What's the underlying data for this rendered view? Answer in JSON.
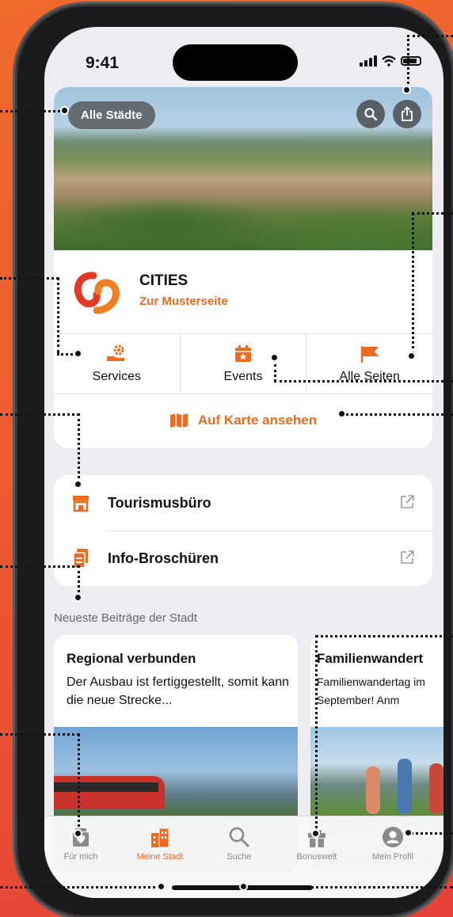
{
  "status": {
    "time": "9:41"
  },
  "header": {
    "all_cities": "Alle Städte"
  },
  "city": {
    "name": "CITIES",
    "link": "Zur Musterseite"
  },
  "actions": [
    {
      "label": "Services",
      "icon": "services-icon"
    },
    {
      "label": "Events",
      "icon": "calendar-star-icon"
    },
    {
      "label": "Alle Seiten",
      "icon": "flag-icon"
    }
  ],
  "map": {
    "label": "Auf Karte ansehen"
  },
  "list": [
    {
      "label": "Tourismusbüro",
      "icon": "store-icon"
    },
    {
      "label": "Info-Broschüren",
      "icon": "documents-icon"
    }
  ],
  "section_title": "Neueste Beiträge der Stadt",
  "posts": [
    {
      "title": "Regional verbunden",
      "text": "Der Ausbau ist fertiggestellt, somit kann die neue Strecke..."
    },
    {
      "title": "Familienwandert",
      "text": "Familienwandertag im September! Anm"
    }
  ],
  "tabs": [
    {
      "label": "Für mich",
      "icon": "heart-box-icon"
    },
    {
      "label": "Meine Stadt",
      "icon": "city-buildings-icon"
    },
    {
      "label": "Suche",
      "icon": "search-icon"
    },
    {
      "label": "Bonuswelt",
      "icon": "gift-icon"
    },
    {
      "label": "Mein Profil",
      "icon": "profile-icon"
    }
  ],
  "colors": {
    "accent": "#ee6a1f",
    "background": "#eeeef2",
    "card": "#ffffff"
  }
}
